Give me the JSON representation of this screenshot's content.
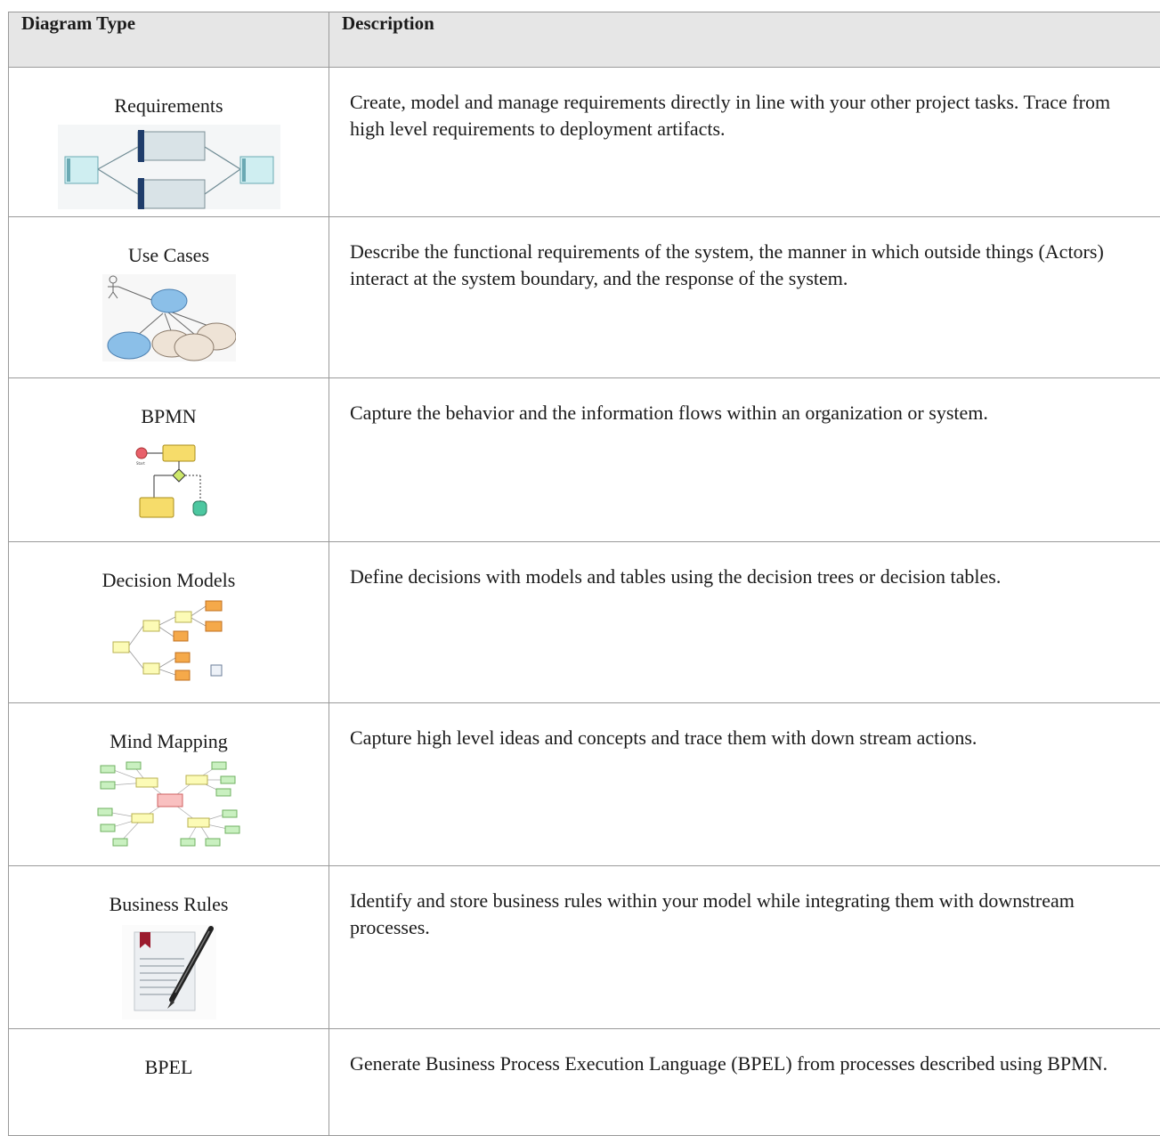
{
  "table": {
    "headers": {
      "type": "Diagram Type",
      "description": "Description"
    },
    "rows": [
      {
        "name": "Requirements",
        "icon": "requirements-diagram-thumbnail",
        "description": "Create, model and manage requirements directly in line with your other project tasks. Trace from high level requirements to deployment artifacts."
      },
      {
        "name": "Use Cases",
        "icon": "use-case-diagram-thumbnail",
        "description": "Describe the functional requirements of the system, the manner in which outside things (Actors) interact at the system boundary, and the response of the system."
      },
      {
        "name": "BPMN",
        "icon": "bpmn-diagram-thumbnail",
        "description": "Capture the behavior and the information flows within an organization or system."
      },
      {
        "name": "Decision Models",
        "icon": "decision-model-diagram-thumbnail",
        "description": "Define decisions with models and tables using the decision trees or decision tables."
      },
      {
        "name": "Mind Mapping",
        "icon": "mind-map-diagram-thumbnail",
        "description": "Capture high level ideas and concepts and trace them with down stream actions."
      },
      {
        "name": "Business Rules",
        "icon": "document-pen-icon",
        "description": "Identify and store business rules within your model while integrating them with downstream processes."
      },
      {
        "name": "BPEL",
        "icon": "",
        "description": "Generate Business Process Execution Language (BPEL) from processes described using BPMN."
      }
    ]
  },
  "colors": {
    "header_bg": "#e6e6e6",
    "border": "#9a9a9a",
    "requirement_fill": "#bfe6ea",
    "usecase_fill": "#8bbfe8",
    "bpmn_task": "#f6dc6a",
    "decision_orange": "#f5a94a",
    "mindmap_green": "#c9f0c0"
  }
}
